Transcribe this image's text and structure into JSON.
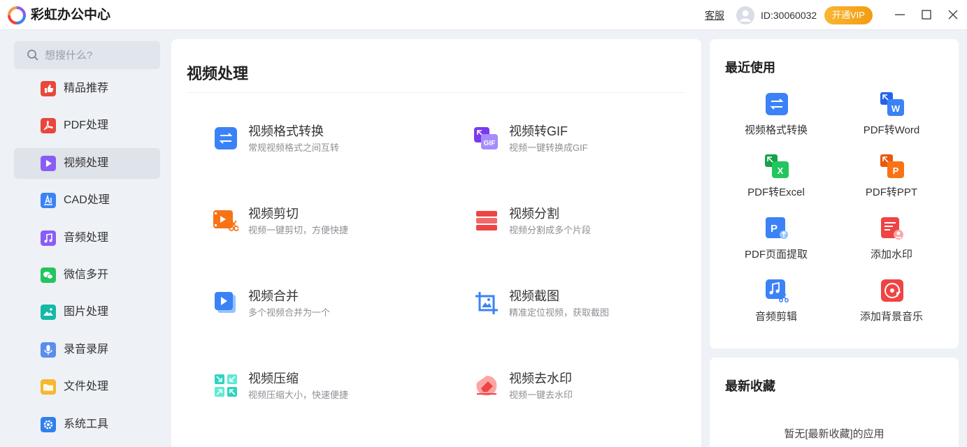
{
  "app": {
    "title": "彩虹办公中心",
    "service_label": "客服",
    "user_id": "ID:30060032",
    "vip_button": "开通VIP"
  },
  "search": {
    "placeholder": "想搜什么?"
  },
  "sidebar": {
    "items": [
      {
        "label": "精品推荐",
        "icon": "thumbs-up-icon",
        "color": "#e8473c"
      },
      {
        "label": "PDF处理",
        "icon": "pdf-icon",
        "color": "#e8473c"
      },
      {
        "label": "视频处理",
        "icon": "play-icon",
        "color": "#8a5cf6",
        "active": true
      },
      {
        "label": "CAD处理",
        "icon": "cad-icon",
        "color": "#3b82f6"
      },
      {
        "label": "音频处理",
        "icon": "music-icon",
        "color": "#8a5cf6"
      },
      {
        "label": "微信多开",
        "icon": "wechat-icon",
        "color": "#22c55e"
      },
      {
        "label": "图片处理",
        "icon": "image-icon",
        "color": "#14b8a6"
      },
      {
        "label": "录音录屏",
        "icon": "microphone-icon",
        "color": "#5b8def"
      },
      {
        "label": "文件处理",
        "icon": "folder-icon",
        "color": "#f5b82e"
      },
      {
        "label": "系统工具",
        "icon": "gear-icon",
        "color": "#2f80ed"
      }
    ]
  },
  "main": {
    "title": "视频处理",
    "tools": [
      {
        "name": "视频格式转换",
        "desc": "常规视频格式之间互转",
        "icon": "format-convert-icon"
      },
      {
        "name": "视频转GIF",
        "desc": "视频一键转换成GIF",
        "icon": "gif-icon"
      },
      {
        "name": "视频剪切",
        "desc": "视频一键剪切，方便快捷",
        "icon": "video-cut-icon"
      },
      {
        "name": "视频分割",
        "desc": "视频分割成多个片段",
        "icon": "video-split-icon"
      },
      {
        "name": "视频合并",
        "desc": "多个视频合并为一个",
        "icon": "video-merge-icon"
      },
      {
        "name": "视频截图",
        "desc": "精准定位视频，获取截图",
        "icon": "crop-icon"
      },
      {
        "name": "视频压缩",
        "desc": "视频压缩大小，快速便捷",
        "icon": "compress-icon"
      },
      {
        "name": "视频去水印",
        "desc": "视频一键去水印",
        "icon": "eraser-icon"
      }
    ]
  },
  "recent": {
    "title": "最近使用",
    "items": [
      {
        "label": "视频格式转换",
        "icon": "format-convert-icon"
      },
      {
        "label": "PDF转Word",
        "icon": "pdf-to-word-icon"
      },
      {
        "label": "PDF转Excel",
        "icon": "pdf-to-excel-icon"
      },
      {
        "label": "PDF转PPT",
        "icon": "pdf-to-ppt-icon"
      },
      {
        "label": "PDF页面提取",
        "icon": "pdf-extract-icon"
      },
      {
        "label": "添加水印",
        "icon": "watermark-icon"
      },
      {
        "label": "音频剪辑",
        "icon": "audio-cut-icon"
      },
      {
        "label": "添加背景音乐",
        "icon": "background-music-icon"
      }
    ]
  },
  "favorites": {
    "title": "最新收藏",
    "empty_text": "暂无[最新收藏]的应用"
  }
}
